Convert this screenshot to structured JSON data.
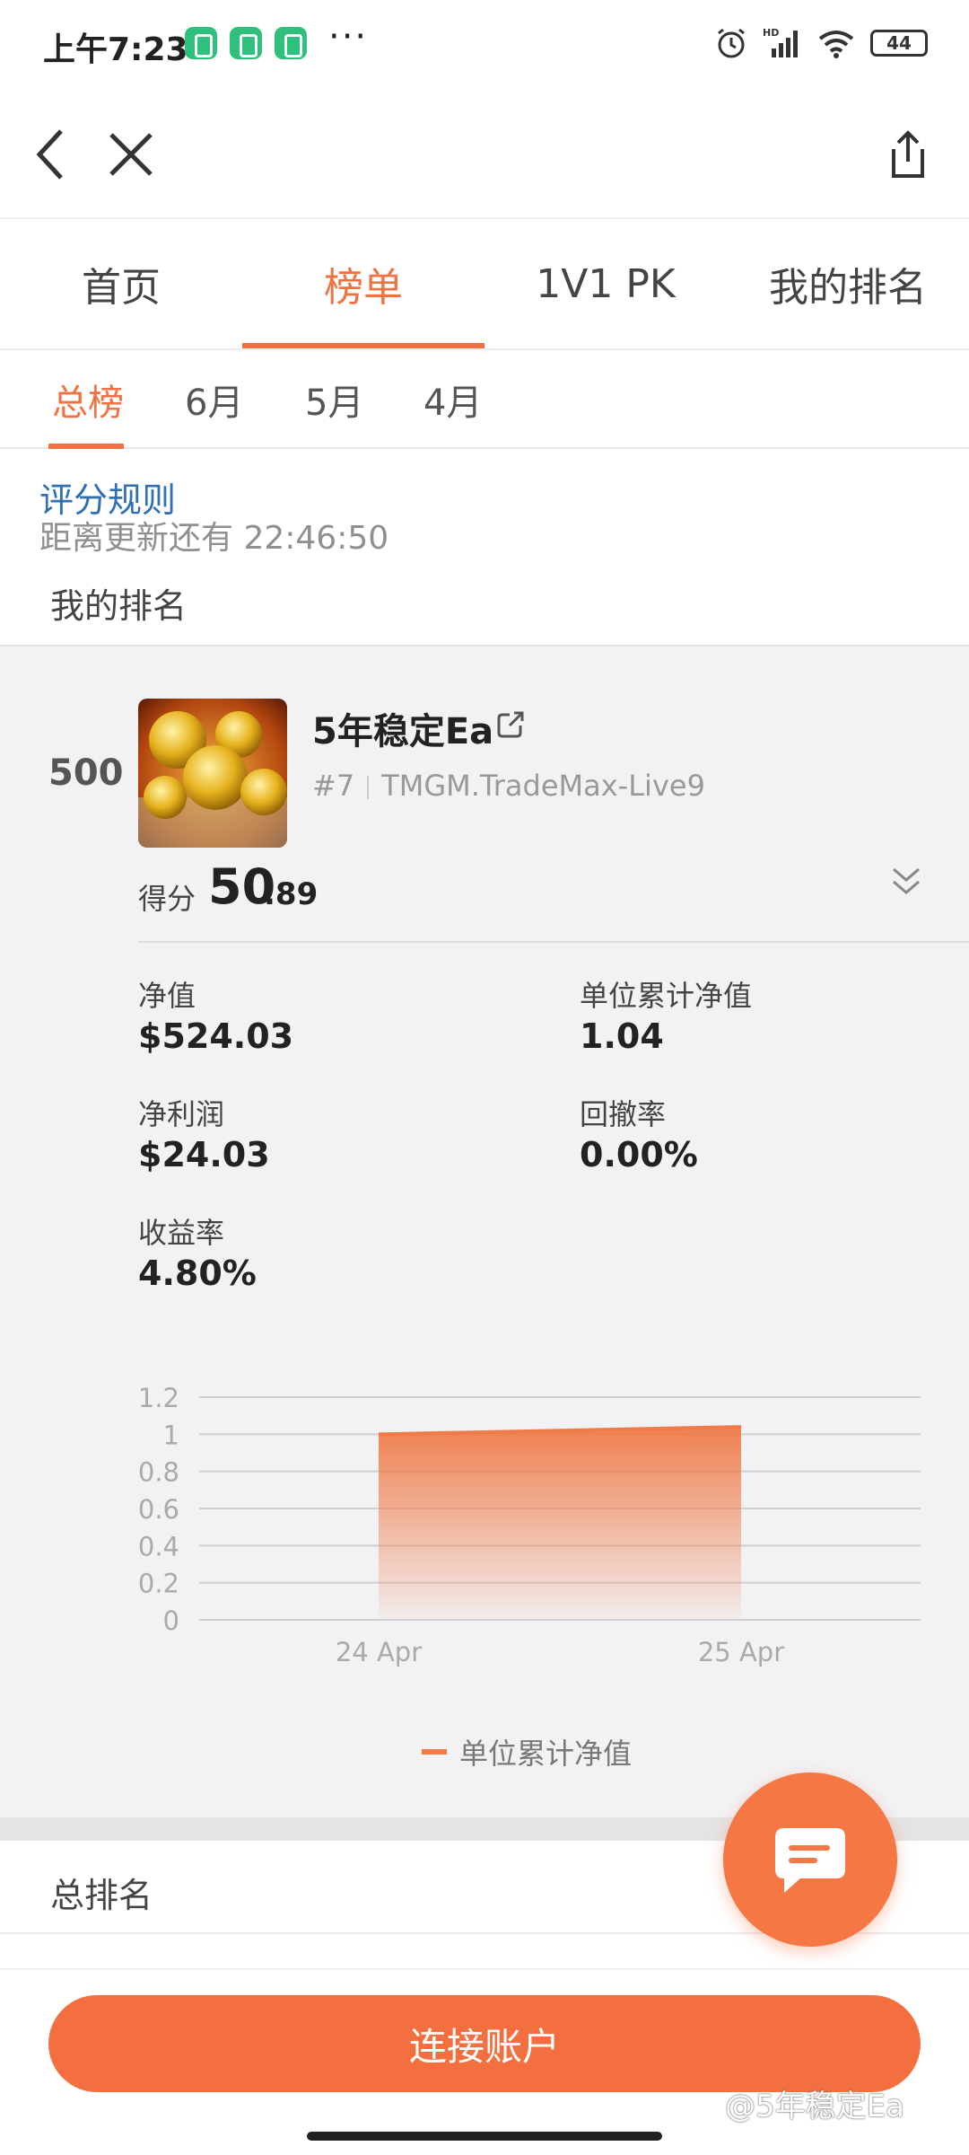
{
  "status_bar": {
    "time": "上午7:23",
    "dots": "···",
    "battery": "44",
    "network": "HD"
  },
  "nav": {
    "back_icon": "chevron-left-icon",
    "close_icon": "close-icon",
    "share_icon": "share-icon"
  },
  "tabs": [
    {
      "label": "首页"
    },
    {
      "label": "榜单",
      "active": true
    },
    {
      "label": "1V1 PK"
    },
    {
      "label": "我的排名"
    }
  ],
  "subtabs": [
    {
      "label": "总榜",
      "active": true
    },
    {
      "label": "6月"
    },
    {
      "label": "5月"
    },
    {
      "label": "4月"
    }
  ],
  "info": {
    "rules_link": "评分规则",
    "countdown": "距离更新还有 22:46:50",
    "my_rank_label": "我的排名"
  },
  "card": {
    "rank": "500",
    "name": "5年稳定Ea",
    "position": "#7",
    "server": "TMGM.TradeMax-Live9",
    "score_label": "得分",
    "score_int": "50",
    "score_dec": ".89",
    "stats": {
      "equity_label": "净值",
      "equity_value": "$524.03",
      "unit_nav_label": "单位累计净值",
      "unit_nav_value": "1.04",
      "net_profit_label": "净利润",
      "net_profit_value": "$24.03",
      "drawdown_label": "回撤率",
      "drawdown_value": "0.00%",
      "return_label": "收益率",
      "return_value": "4.80%"
    }
  },
  "chart_data": {
    "type": "area",
    "x": [
      "24 Apr",
      "25 Apr"
    ],
    "series": [
      {
        "name": "单位累计净值",
        "values": [
          1.0,
          1.04
        ]
      }
    ],
    "yticks": [
      "1.2",
      "1",
      "0.8",
      "0.6",
      "0.4",
      "0.2",
      "0"
    ],
    "ylim": [
      0,
      1.2
    ],
    "grid": true,
    "legend": "bottom-center",
    "color": "#f07a48"
  },
  "bottom": {
    "total_rank_label": "总排名",
    "connect_button": "连接账户",
    "watermark": "@5年稳定Ea",
    "chat_icon": "chat-bubble-icon"
  }
}
